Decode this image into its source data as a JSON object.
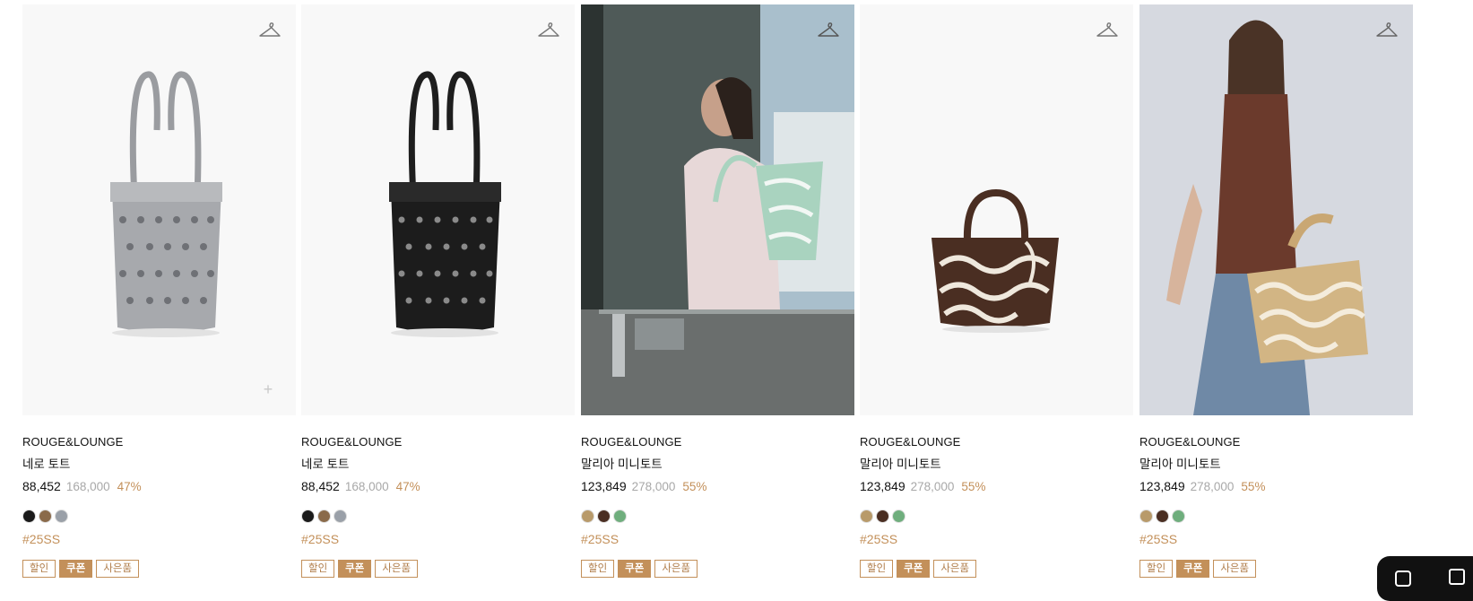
{
  "products": [
    {
      "brand": "ROUGE&LOUNGE",
      "name": "네로 토트",
      "sale_price": "88,452",
      "original_price": "168,000",
      "discount": "47%",
      "swatch_colors": [
        "#1a1a1a",
        "#8a6a4a",
        "#9aa0a8"
      ],
      "hashtag": "#25SS",
      "chips": [
        "할인",
        "쿠폰",
        "사은품"
      ],
      "image_semantic": "silver-crochet-bead-tote"
    },
    {
      "brand": "ROUGE&LOUNGE",
      "name": "네로 토트",
      "sale_price": "88,452",
      "original_price": "168,000",
      "discount": "47%",
      "swatch_colors": [
        "#1a1a1a",
        "#8a6a4a",
        "#9aa0a8"
      ],
      "hashtag": "#25SS",
      "chips": [
        "할인",
        "쿠폰",
        "사은품"
      ],
      "image_semantic": "black-crochet-bead-tote"
    },
    {
      "brand": "ROUGE&LOUNGE",
      "name": "말리아 미니토트",
      "sale_price": "123,849",
      "original_price": "278,000",
      "discount": "55%",
      "swatch_colors": [
        "#b89a6a",
        "#4a2e22",
        "#6fae7d"
      ],
      "hashtag": "#25SS",
      "chips": [
        "할인",
        "쿠폰",
        "사은품"
      ],
      "image_semantic": "model-with-mint-tote"
    },
    {
      "brand": "ROUGE&LOUNGE",
      "name": "말리아 미니토트",
      "sale_price": "123,849",
      "original_price": "278,000",
      "discount": "55%",
      "swatch_colors": [
        "#b89a6a",
        "#4a2e22",
        "#6fae7d"
      ],
      "hashtag": "#25SS",
      "chips": [
        "할인",
        "쿠폰",
        "사은품"
      ],
      "image_semantic": "brown-chain-pattern-mini-tote"
    },
    {
      "brand": "ROUGE&LOUNGE",
      "name": "말리아 미니토트",
      "sale_price": "123,849",
      "original_price": "278,000",
      "discount": "55%",
      "swatch_colors": [
        "#b89a6a",
        "#4a2e22",
        "#6fae7d"
      ],
      "hashtag": "#25SS",
      "chips": [
        "할인",
        "쿠폰",
        "사은품"
      ],
      "image_semantic": "model-with-beige-tote"
    }
  ],
  "icons": {
    "wishlist": "hanger-icon",
    "add": "plus-icon"
  },
  "colors": {
    "accent": "#c3905a",
    "muted": "#a8a8a8",
    "text": "#111111"
  }
}
